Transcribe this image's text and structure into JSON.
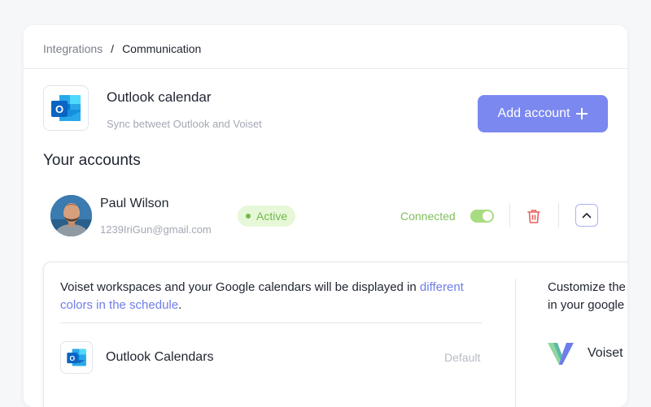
{
  "breadcrumb": {
    "items": [
      "Integrations",
      "Communication"
    ],
    "separator": "/"
  },
  "integration": {
    "title": "Outlook calendar",
    "subtitle": "Sync betweet Outlook and Voiset",
    "logo_icon": "outlook-icon"
  },
  "actions": {
    "add_account_label": "Add account",
    "add_icon": "plus-icon"
  },
  "accounts_section": {
    "title": "Your accounts"
  },
  "account": {
    "name": "Paul Wilson",
    "email": "1239IriGun@gmail.com",
    "status": "Active",
    "connection_label": "Connected",
    "toggle_on": true
  },
  "detail": {
    "text_prefix": "Voiset workspaces and your Google calendars will be displayed in",
    "link_text": "different colors in the schedule",
    "text_suffix": ".",
    "calendar_title": "Outlook Calendars",
    "calendar_default_label": "Default",
    "right_text_line1": "Customize the",
    "right_text_line2": "in your google",
    "right_app_name": "Voiset"
  },
  "colors": {
    "accent": "#7b88f0",
    "active_green": "#74b84c",
    "active_bg": "#e6f8d8",
    "delete_red": "#e8605a",
    "link": "#6f7de9"
  }
}
